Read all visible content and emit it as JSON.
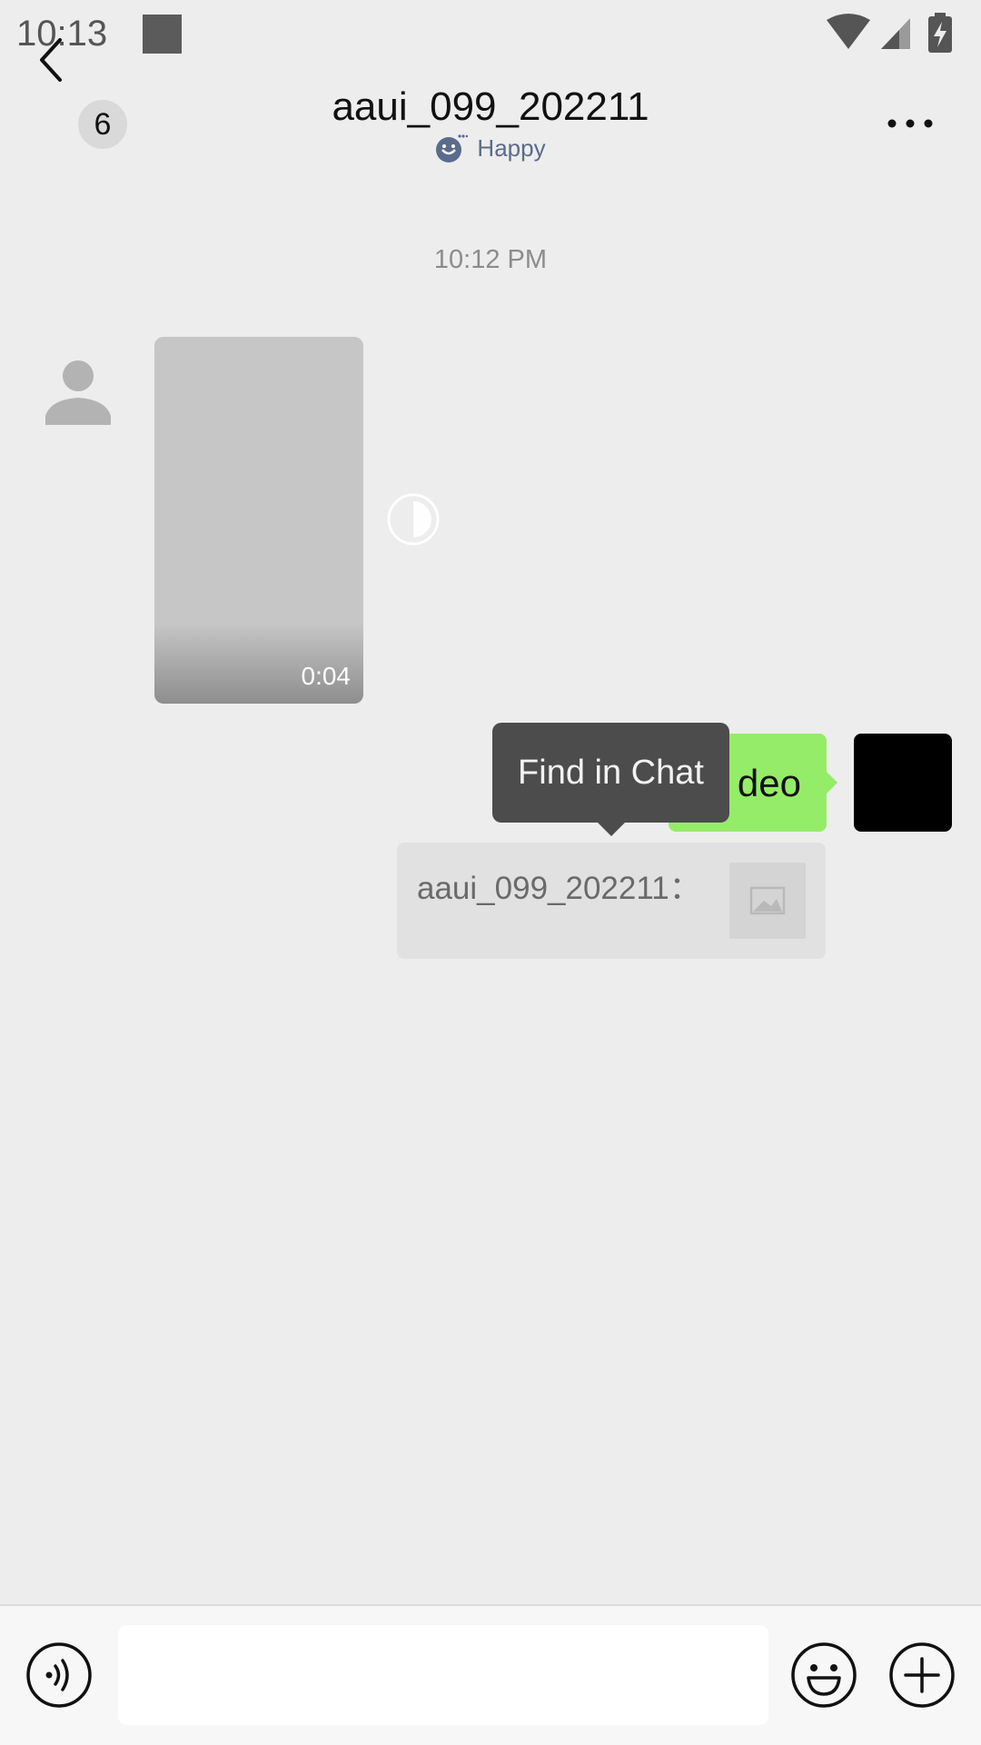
{
  "status_bar": {
    "time": "10:13"
  },
  "header": {
    "unread_count": "6",
    "title": "aaui_099_202211",
    "status_text": "Happy"
  },
  "messages": {
    "timestamp": "10:12 PM",
    "video": {
      "duration": "0:04"
    },
    "outgoing_text": "deo",
    "quote": {
      "sender": "aaui_099_202211："
    }
  },
  "tooltip": {
    "label": "Find in Chat"
  },
  "input": {
    "placeholder": ""
  },
  "colors": {
    "background": "#ededed",
    "outgoing_bubble": "#95ec69",
    "tooltip": "#4c4c4c",
    "status_accent": "#5b6b8c"
  },
  "icons": [
    "back-icon",
    "mood-icon",
    "more-icon",
    "contact-avatar-icon",
    "video-status-icon",
    "image-placeholder-icon",
    "voice-icon",
    "emoji-icon",
    "plus-icon",
    "wifi-icon",
    "signal-icon",
    "battery-icon"
  ]
}
